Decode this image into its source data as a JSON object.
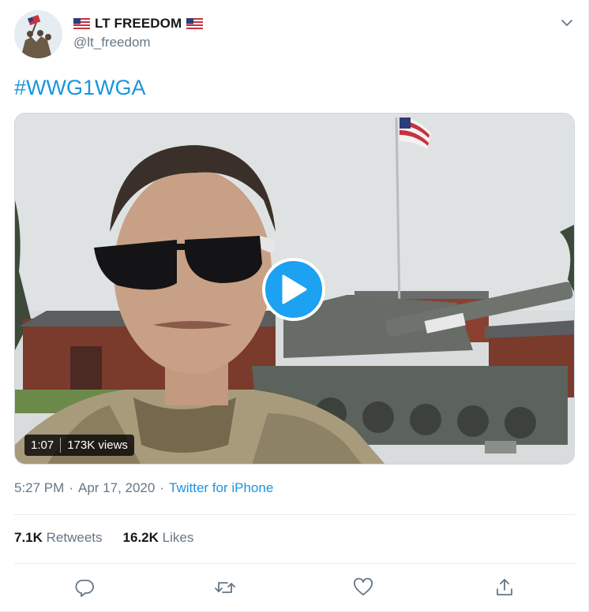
{
  "author": {
    "display_name": "LT FREEDOM",
    "handle": "@lt_freedom",
    "avatar_icon": "avatar-flag-raising",
    "flag_emoji": "us-flag"
  },
  "tweet": {
    "text": "#WWG1WGA",
    "timestamp": "5:27 PM",
    "separator": "·",
    "date": "Apr 17, 2020",
    "source": "Twitter for iPhone"
  },
  "media": {
    "type": "video",
    "duration": "1:07",
    "views": "173K views",
    "play_icon": "play-icon"
  },
  "engagement": {
    "retweets_count": "7.1K",
    "retweets_label": "Retweets",
    "likes_count": "16.2K",
    "likes_label": "Likes"
  },
  "actions": [
    {
      "name": "reply",
      "icon": "reply-icon"
    },
    {
      "name": "retweet",
      "icon": "retweet-icon"
    },
    {
      "name": "like",
      "icon": "heart-icon"
    },
    {
      "name": "share",
      "icon": "share-icon"
    }
  ],
  "colors": {
    "accent": "#1da1f2",
    "link": "#1b95e0",
    "secondary_text": "#657786",
    "primary_text": "#14171a",
    "border": "#e6ecf0"
  }
}
